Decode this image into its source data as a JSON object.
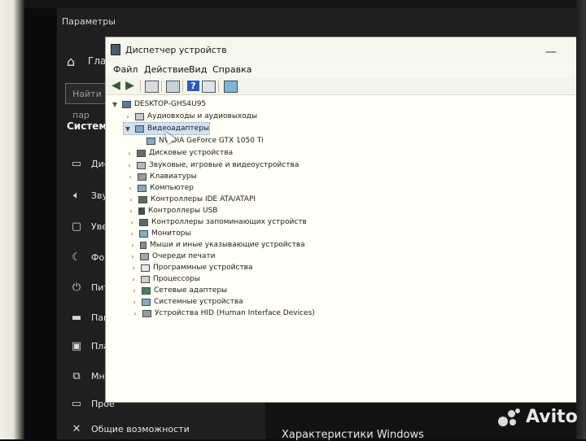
{
  "settings": {
    "title": "Параметры",
    "home_label": "Глав",
    "search_placeholder": "Найти пар",
    "section_title": "Система",
    "nav_items": [
      {
        "label": "Дисп",
        "icon": "display-icon"
      },
      {
        "label": "Звук",
        "icon": "sound-icon"
      },
      {
        "label": "Увед",
        "icon": "notifications-icon"
      },
      {
        "label": "Фоку",
        "icon": "focus-assist-icon"
      },
      {
        "label": "Пита",
        "icon": "power-icon"
      },
      {
        "label": "Памя",
        "icon": "storage-icon"
      },
      {
        "label": "План",
        "icon": "tablet-icon"
      },
      {
        "label": "Мно",
        "icon": "multitasking-icon"
      },
      {
        "label": "Прое",
        "icon": "projecting-icon"
      },
      {
        "label": "Общие возможности",
        "icon": "shared-experiences-icon"
      }
    ],
    "bottom_heading": "Характеристики Windows"
  },
  "device_manager": {
    "title": "Диспетчер устройств",
    "menu": [
      "Файл",
      "Действие",
      "Вид",
      "Справка"
    ],
    "toolbar_icons": [
      "back-icon",
      "forward-icon",
      "properties-icon",
      "view-icon",
      "help-icon",
      "show-hidden-icon",
      "scan-hardware-icon"
    ],
    "root": "DESKTOP-GHS4U95",
    "categories": [
      {
        "label": "Аудиовходы и аудиовыходы",
        "expanded": false
      },
      {
        "label": "Видеоадаптеры",
        "expanded": true,
        "selected": true,
        "children": [
          "NVIDIA GeForce GTX 1050 Ti"
        ]
      },
      {
        "label": "Дисковые устройства",
        "expanded": false
      },
      {
        "label": "Звуковые, игровые и видеоустройства",
        "expanded": false
      },
      {
        "label": "Клавиатуры",
        "expanded": false
      },
      {
        "label": "Компьютер",
        "expanded": false
      },
      {
        "label": "Контроллеры IDE ATA/ATAPI",
        "expanded": false
      },
      {
        "label": "Контроллеры USB",
        "expanded": false
      },
      {
        "label": "Контроллеры запоминающих устройств",
        "expanded": false
      },
      {
        "label": "Мониторы",
        "expanded": false
      },
      {
        "label": "Мыши и иные указывающие устройства",
        "expanded": false
      },
      {
        "label": "Очереди печати",
        "expanded": false
      },
      {
        "label": "Программные устройства",
        "expanded": false
      },
      {
        "label": "Процессоры",
        "expanded": false
      },
      {
        "label": "Сетевые адаптеры",
        "expanded": false
      },
      {
        "label": "Системные устройства",
        "expanded": false
      },
      {
        "label": "Устройства HID (Human Interface Devices)",
        "expanded": false
      }
    ]
  },
  "watermark": {
    "brand": "Avito"
  }
}
